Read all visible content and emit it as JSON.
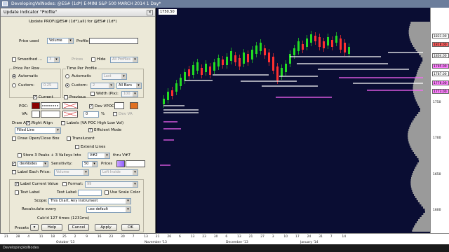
{
  "window": {
    "title": "DevelopingVolNodes: @ES# (1d*) E-MINI S&P 500 MARCH 2014 1 Day*"
  },
  "chart": {
    "price_box": "1750.50",
    "price_labels": [
      "1831.00",
      "1818.00",
      "1804.00",
      "1795.00",
      "1787.00",
      "1776.00",
      "1773.00"
    ],
    "price_label_colors": [
      "#ffffff",
      "#ff6060",
      "#ffffff",
      "#ff80ff",
      "#ffffff",
      "#ff80ff",
      "#ff80ff"
    ],
    "axis_labels": [
      "1750",
      "1700",
      "1650",
      "1600"
    ],
    "x_ticks": [
      "21",
      "28",
      "4",
      "11",
      "18",
      "25",
      "2",
      "9",
      "16",
      "23",
      "30",
      "7",
      "13",
      "21",
      "26",
      "6",
      "13",
      "23",
      "30",
      "6",
      "13",
      "21",
      "27",
      "3",
      "10",
      "17",
      "24",
      "31",
      "7",
      "14"
    ],
    "x_months": [
      "October '13",
      "November '13",
      "December '13",
      "January '14"
    ],
    "status_text": "DevelopingVolNodes",
    "colors": {
      "up": "#22dd22",
      "down": "#ff3030",
      "node_white": "#ffffff",
      "node_magenta": "#ff66ff",
      "background": "#0a0d33"
    }
  },
  "dialog": {
    "title": "Update Indicator \"Profile\"",
    "heading": "Update PROF(@ES# (1d*),all) for @ES# (1d*)",
    "price_used_label": "Price used",
    "price_used_value": "Volume",
    "profile_label": "Profile",
    "smoothed_label": "Smoothed ...",
    "smoothed_value": "3",
    "prices_label": "Prices",
    "hide_label": "Hide",
    "hide_value": "All Profiles",
    "price_per_row": {
      "label": "Price Per Row",
      "automatic": "Automatic",
      "custom": "Custom:",
      "custom_value": "0.25"
    },
    "time_per_profile": {
      "label": "Time Per Profile",
      "automatic": "Automatic",
      "automatic_value": "Last",
      "custom": "Custom:",
      "custom_value": "2",
      "custom_unit": "All Bars"
    },
    "current_label": "Current",
    "previous_label": "Previous",
    "width_label": "Width (Pix):",
    "width_value": "100",
    "poc_label": "POC:",
    "va_label": "VA:",
    "dev_vpoc_label": "Dev VPOC",
    "dev_va_label": "Dev VA",
    "pct_value": "0",
    "pct_unit": "%",
    "draw_as_label": "Draw As...",
    "right_align_label": "Right Align",
    "labels_label": "Labels (VA POC High Low Vol)",
    "draw_as_value": "Filled Line",
    "efficient_mode_label": "Efficient Mode",
    "draw_open_close_label": "Draw Open/Close Box",
    "translucent_label": "Translucent",
    "extend_lines_label": "Extend Lines",
    "store_label": "Store 3 Peaks + 3 Valleys Into",
    "store_var_value": "V#2",
    "thru_label": "thru V#7",
    "nodes_value": "devNodes",
    "sensitivity_label": "Sensitivity:",
    "sensitivity_value": "50",
    "prices_label2": "Prices",
    "label_each_price": "Label Each Price:",
    "label_each_value": "Volume",
    "label_each_value2": "Left Inside",
    "label_current_value": "Label Current Value",
    "format_label": "Format:",
    "format_value": "99",
    "text_label_cb": "Text Label",
    "text_label_field": "Text Label:",
    "use_scale_color": "Use Scale Color",
    "scope_label": "Scope:",
    "scope_value": "This Chart, Any Instrument",
    "recalc_label": "Recalculate every",
    "recalc_value": "use default",
    "calcd_label": "Calc'd 127 times (1231ms)",
    "presets_label": "Presets",
    "help_button": "Help",
    "cancel_button": "Cancel",
    "apply_button": "Apply",
    "ok_button": "OK"
  }
}
